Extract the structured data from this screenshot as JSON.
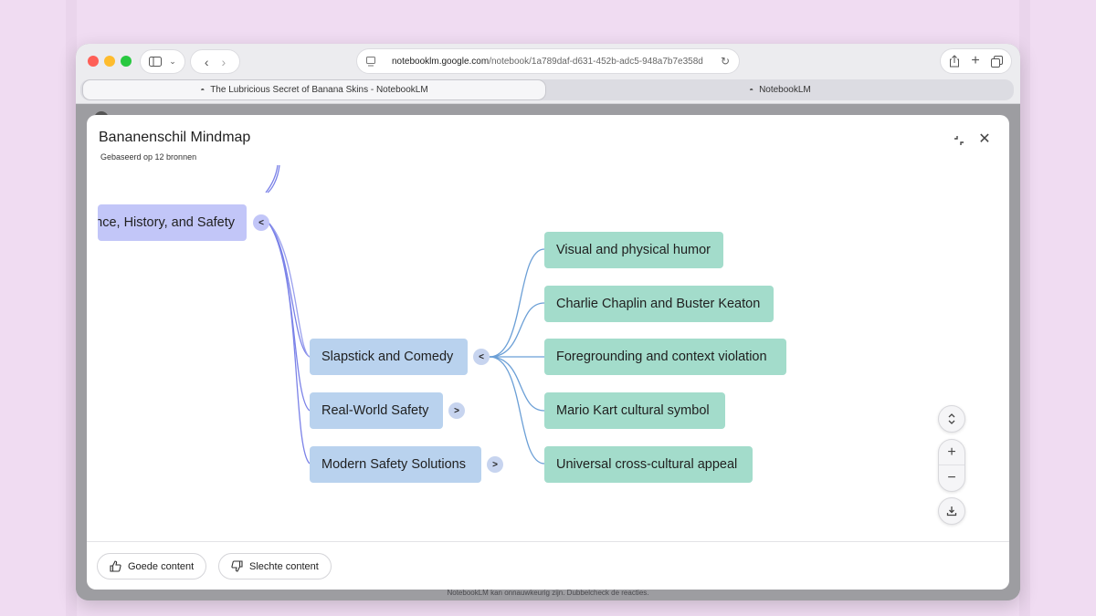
{
  "browser": {
    "url_domain": "notebooklm.google.com",
    "url_path": "/notebook/1a789daf-d631-452b-adc5-948a7b7e358d",
    "tabs": [
      {
        "label": "The Lubricious Secret of Banana Skins - NotebookLM",
        "active": true
      },
      {
        "label": "NotebookLM",
        "active": false
      }
    ]
  },
  "modal": {
    "title": "Bananenschil Mindmap",
    "subtitle": "Gebaseerd op 12 bronnen",
    "close_icon": "close-icon",
    "collapse_icon": "collapse-icon"
  },
  "mindmap": {
    "root": {
      "label": "Science, History, and Safety",
      "visible_label": "nce, History, and Safety",
      "toggle": "<"
    },
    "branches": [
      {
        "label": "Slapstick and Comedy",
        "toggle": "<",
        "expanded": true
      },
      {
        "label": "Real-World Safety",
        "toggle": ">",
        "expanded": false
      },
      {
        "label": "Modern Safety Solutions",
        "toggle": ">",
        "expanded": false
      }
    ],
    "leaves": [
      {
        "label": "Visual and physical humor"
      },
      {
        "label": "Charlie Chaplin and Buster Keaton"
      },
      {
        "label": "Foregrounding and context violation"
      },
      {
        "label": "Mario Kart cultural symbol"
      },
      {
        "label": "Universal cross-cultural appeal"
      }
    ],
    "colors": {
      "root": "#c2c6f8",
      "branch": "#b9d2ee",
      "leaf": "#a3dccb",
      "root_link": "#7b82e8",
      "leaf_link": "#6b9fd6"
    }
  },
  "controls": {
    "fit_icon": "expand-collapse-icon",
    "zoom_in": "+",
    "zoom_out": "−",
    "download_icon": "download-icon"
  },
  "footer": {
    "good_label": "Goede content",
    "bad_label": "Slechte content",
    "disclaimer": "NotebookLM kan onnauwkeurig zijn. Dubbelcheck de reacties."
  }
}
